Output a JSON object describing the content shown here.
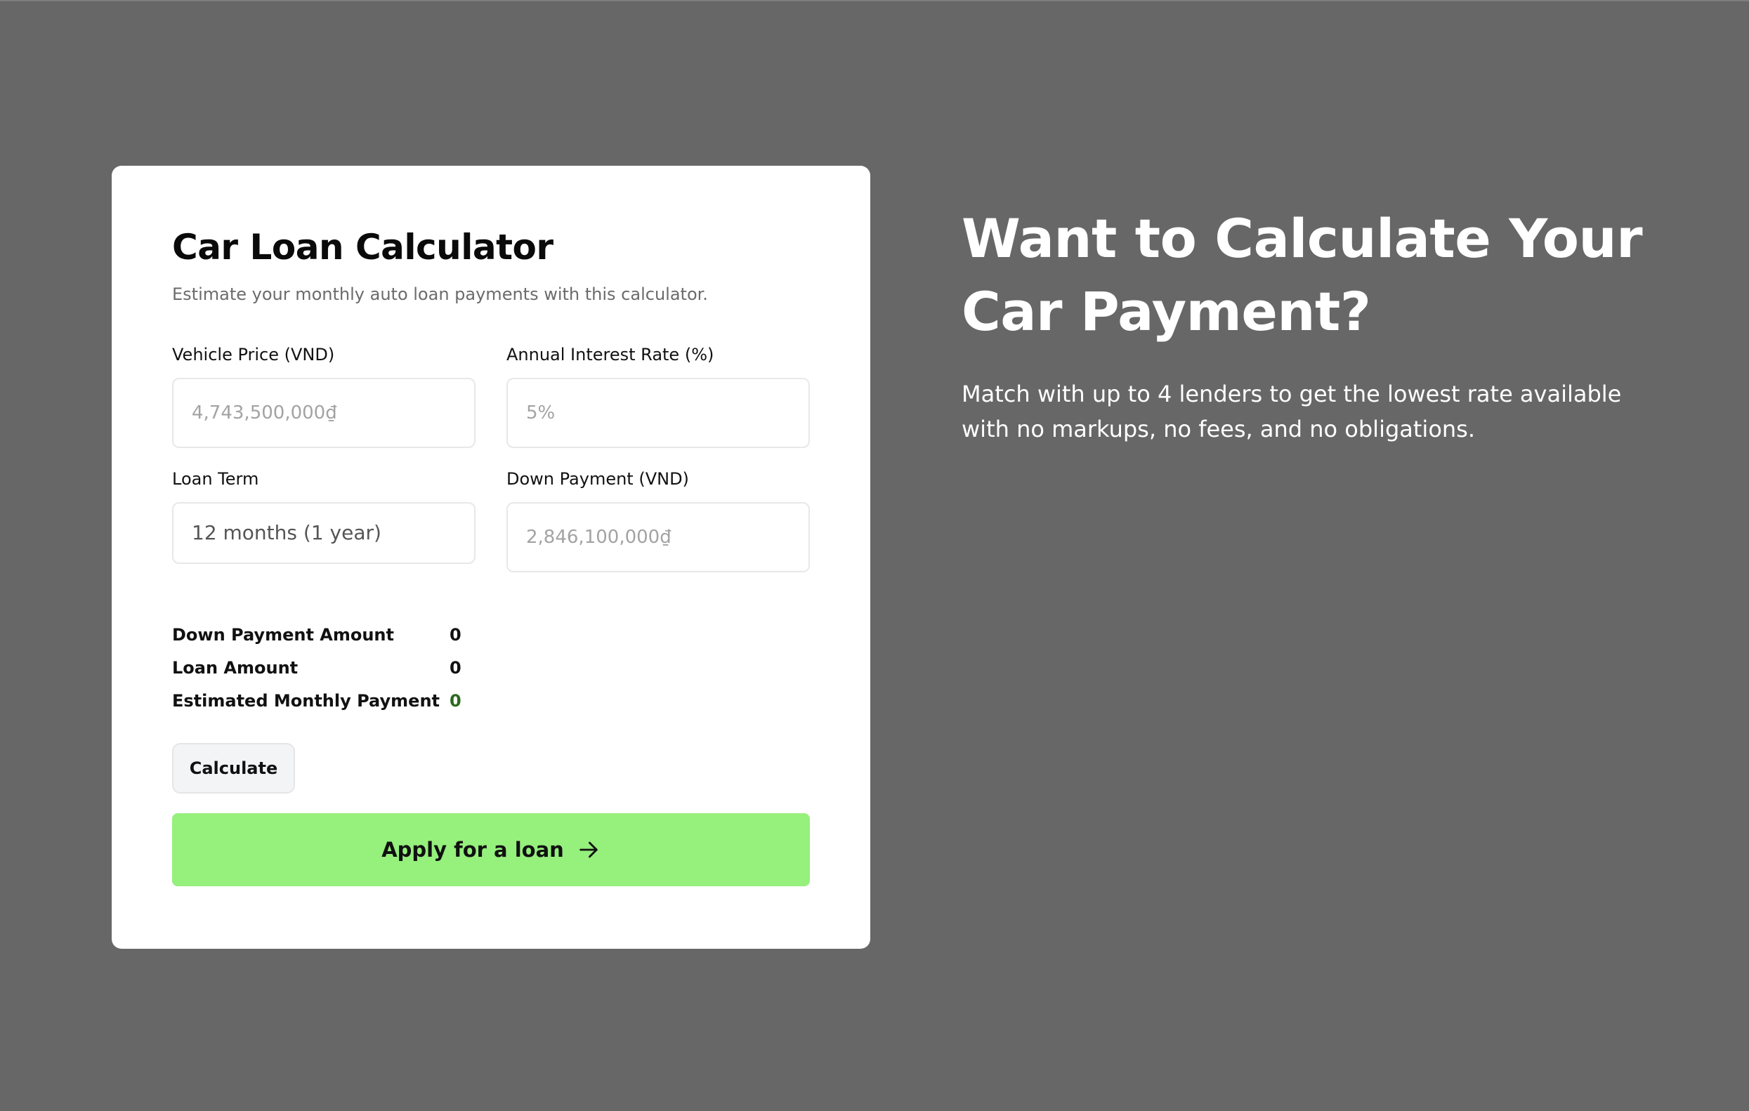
{
  "calculator": {
    "title": "Car Loan Calculator",
    "subtitle": "Estimate your monthly auto loan payments with this calculator.",
    "fields": {
      "vehicle_price": {
        "label": "Vehicle Price (VND)",
        "placeholder": "4,743,500,000₫"
      },
      "interest_rate": {
        "label": "Annual Interest Rate (%)",
        "placeholder": "5%"
      },
      "loan_term": {
        "label": "Loan Term",
        "selected": "12 months (1 year)"
      },
      "down_payment": {
        "label": "Down Payment (VND)",
        "placeholder": "2,846,100,000₫"
      }
    },
    "results": {
      "down_payment_amount": {
        "label": "Down Payment Amount",
        "value": "0"
      },
      "loan_amount": {
        "label": "Loan Amount",
        "value": "0"
      },
      "monthly_payment": {
        "label": "Estimated Monthly Payment",
        "value": "0"
      }
    },
    "calculate_label": "Calculate",
    "apply_label": "Apply for a loan"
  },
  "hero": {
    "title": "Want to Calculate Your Car Payment?",
    "text": "Match with up to 4 lenders to get the lowest rate available with no markups, no fees, and no obligations."
  },
  "colors": {
    "background": "#676767",
    "card": "#ffffff",
    "apply_button": "#95f07c",
    "monthly_value": "#2a6a1e"
  }
}
